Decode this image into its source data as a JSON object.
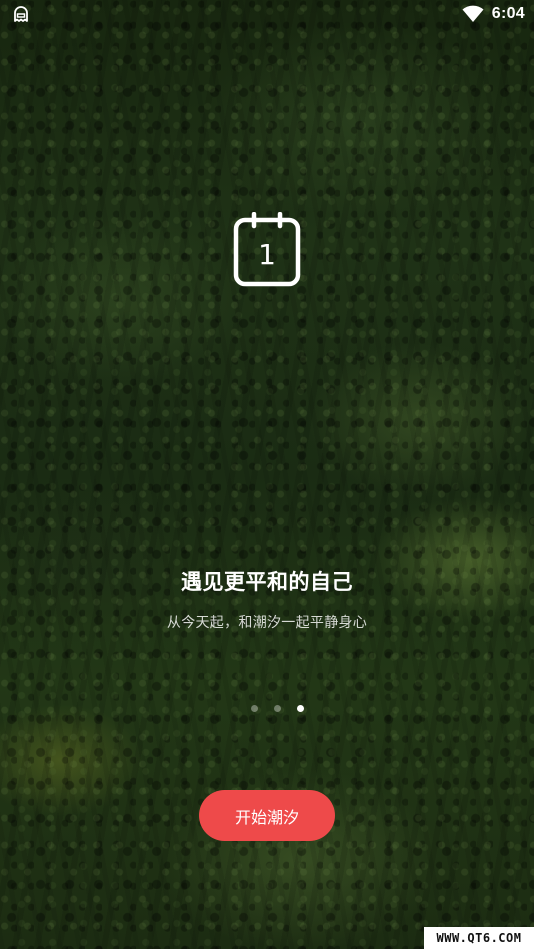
{
  "status_bar": {
    "left_icon": "ghost-notification-icon",
    "wifi_icon": "wifi-icon",
    "time": "6:04"
  },
  "calendar": {
    "icon": "calendar-icon",
    "day": "1"
  },
  "headline": "遇见更平和的自己",
  "subline": "从今天起，和潮汐一起平静身心",
  "pager": {
    "total": 3,
    "active_index": 2
  },
  "start_button": {
    "label": "开始潮汐",
    "color": "#ee4a4a"
  },
  "watermark": "WWW.QT6.COM"
}
